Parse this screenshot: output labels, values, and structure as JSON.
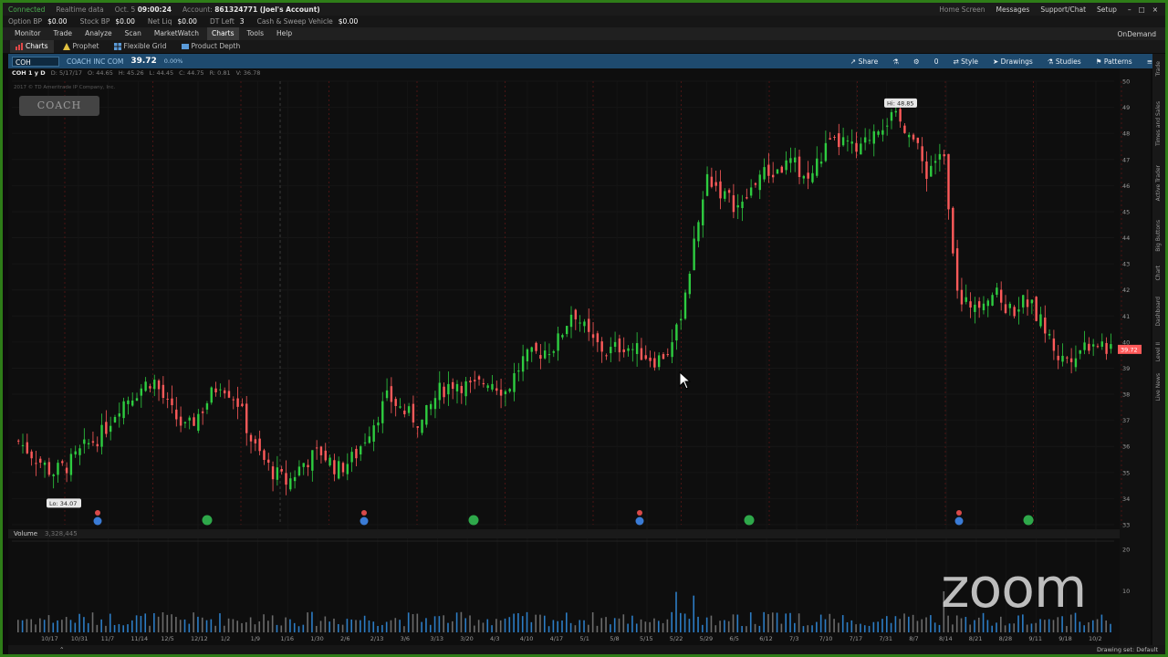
{
  "statusbar": {
    "status": "Connected",
    "data": "Realtime data",
    "date": "Oct. 5",
    "time": "09:00:24",
    "account_label": "Account:",
    "account_value": "861324771 (Joel's Account)",
    "home": "Home Screen",
    "messages": "Messages",
    "support": "Support/Chat",
    "setup": "Setup"
  },
  "acct": [
    {
      "label": "Option BP",
      "value": "$0.00"
    },
    {
      "label": "Stock BP",
      "value": "$0.00"
    },
    {
      "label": "Net Liq",
      "value": "$0.00"
    },
    {
      "label": "DT Left",
      "value": "3"
    },
    {
      "label": "Cash & Sweep Vehicle",
      "value": "$0.00"
    }
  ],
  "menu": {
    "items": [
      "Monitor",
      "Trade",
      "Analyze",
      "Scan",
      "MarketWatch",
      "Charts",
      "Tools",
      "Help"
    ],
    "active": "Charts",
    "ondemand": "OnDemand"
  },
  "subtabs": {
    "items": [
      "Charts",
      "Prophet",
      "Flexible Grid",
      "Product Depth"
    ],
    "active": "Charts"
  },
  "charttool": {
    "symbol": "COH",
    "description": "COACH INC COM",
    "price": "39.72",
    "change": "0.00%",
    "share": "Share",
    "zero": "0",
    "style": "Style",
    "drawings": "Drawings",
    "studies": "Studies",
    "patterns": "Patterns"
  },
  "chart": {
    "ohlc_ticker": "COH 1 y D",
    "ohlc": [
      "D: 5/17/17",
      "O: 44.65",
      "H: 45.26",
      "L: 44.45",
      "C: 44.75",
      "R: 0.81",
      "V: 36.78"
    ],
    "copyright": "2017 © TD Ameritrade IP Company, Inc.",
    "logo": "COACH",
    "hi_label": "Hi: 48.85",
    "lo_label": "Lo: 34.07",
    "last_badge": "39.72",
    "volume_label": "Volume",
    "volume_value": "3,328,445"
  },
  "chart_data": {
    "type": "candlestick",
    "title": "",
    "ylim": [
      33,
      50
    ],
    "y_ticks": [
      33,
      34,
      35,
      36,
      37,
      38,
      39,
      40,
      41,
      42,
      43,
      44,
      45,
      46,
      47,
      48,
      49,
      50
    ],
    "x_ticks": [
      "10/17",
      "10/31",
      "11/7",
      "11/14",
      "12/5",
      "12/12",
      "1/2",
      "1/9",
      "1/16",
      "1/30",
      "2/6",
      "2/13",
      "3/6",
      "3/13",
      "3/20",
      "4/3",
      "4/10",
      "4/17",
      "5/1",
      "5/8",
      "5/15",
      "5/22",
      "5/29",
      "6/5",
      "6/12",
      "7/3",
      "7/10",
      "7/17",
      "7/31",
      "8/7",
      "8/14",
      "8/21",
      "8/28",
      "9/11",
      "9/18",
      "10/2"
    ],
    "path_close": [
      36.2,
      35.6,
      35.0,
      35.3,
      36.0,
      36.5,
      37.6,
      38.1,
      38.6,
      37.4,
      36.6,
      37.5,
      38.5,
      37.8,
      36.0,
      35.1,
      34.6,
      35.4,
      35.8,
      35.1,
      35.6,
      36.8,
      37.9,
      37.3,
      36.9,
      38.1,
      38.5,
      38.2,
      38.6,
      38.1,
      39.3,
      39.6,
      39.9,
      41.3,
      40.1,
      39.6,
      39.9,
      39.6,
      39.3,
      39.9,
      43.0,
      46.4,
      45.6,
      45.1,
      46.4,
      46.5,
      46.9,
      46.2,
      47.4,
      47.7,
      47.2,
      48.3,
      48.6,
      48.2,
      46.5,
      47.4,
      41.3,
      41.6,
      41.9,
      41.2,
      41.6,
      40.6,
      39.3,
      39.7,
      40.1,
      39.7
    ],
    "hi_value": 48.85,
    "lo_value": 34.07,
    "last_price": 39.72,
    "volume_ticks": [
      10,
      20
    ],
    "volume_unit": "millions",
    "colors": {
      "up": "#2ecc40",
      "down": "#ff5a5a",
      "event_blue": "#3a7bd5",
      "event_green": "#2ea84a"
    }
  },
  "bottombar": {
    "drawing_set": "Drawing set: Default"
  },
  "sidebar": [
    "Trade",
    "Times and Sales",
    "Active Trader",
    "Big Buttons",
    "Chart",
    "Dashboard",
    "Level II",
    "Live News"
  ],
  "watermark": "zoom"
}
